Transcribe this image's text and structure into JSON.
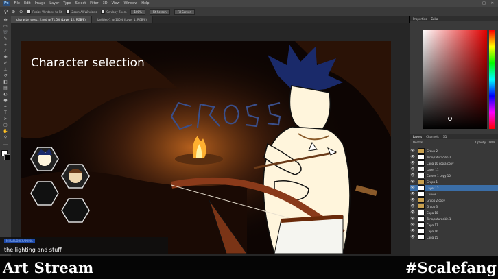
{
  "menubar": {
    "app_logo": "Ps",
    "items": [
      "File",
      "Edit",
      "Image",
      "Layer",
      "Type",
      "Select",
      "Filter",
      "3D",
      "View",
      "Window",
      "Help"
    ]
  },
  "options_bar": {
    "checkboxes": [
      "Resize Windows to Fit",
      "Zoom All Windows",
      "Scrubby Zoom"
    ],
    "buttons": [
      "100%",
      "Fit Screen",
      "Fill Screen"
    ]
  },
  "document_tabs": [
    {
      "label": "character select 2.psd @ 71.5% (Layer 12, RGB/8)",
      "active": true
    },
    {
      "label": "Untitled-1 @ 100% (Layer 1, RGB/8)",
      "active": false
    }
  ],
  "right_panel": {
    "color_tabs": [
      "Properties",
      "Color"
    ],
    "layers_tabs": [
      "Layers",
      "Channels",
      "3D"
    ],
    "blend_mode": "Normal",
    "opacity_label": "Opacity: 100%",
    "layers": [
      {
        "name": "Group 2",
        "folder": true,
        "selected": false
      },
      {
        "name": "Tono/saturación 2",
        "folder": false,
        "selected": false
      },
      {
        "name": "Capa 10 copia copy",
        "folder": false,
        "selected": false
      },
      {
        "name": "Layer 11",
        "folder": false,
        "selected": false
      },
      {
        "name": "Curves 1 copy 10",
        "folder": false,
        "selected": false
      },
      {
        "name": "Grupo 1",
        "folder": true,
        "selected": false
      },
      {
        "name": "Layer 12",
        "folder": false,
        "selected": true
      },
      {
        "name": "Curves 1",
        "folder": false,
        "selected": false
      },
      {
        "name": "Grupo 2 copy",
        "folder": true,
        "selected": false
      },
      {
        "name": "Grupo 3",
        "folder": true,
        "selected": false
      },
      {
        "name": "Capa 18",
        "folder": false,
        "selected": false
      },
      {
        "name": "Tono/saturación 1",
        "folder": false,
        "selected": false
      },
      {
        "name": "Capa 17",
        "folder": false,
        "selected": false
      },
      {
        "name": "Capa 16",
        "folder": false,
        "selected": false
      },
      {
        "name": "Capa 15",
        "folder": false,
        "selected": false
      }
    ]
  },
  "canvas": {
    "title": "Character selection",
    "logo_text": "CROSS"
  },
  "subtitle": {
    "speaker": "MIRAFLORESANIMA",
    "text": "the lighting and stuff"
  },
  "stream_overlay": {
    "left": "Art Stream",
    "right": "#Scalefang"
  },
  "colors": {
    "accent_blue": "#3b6ea7",
    "fire": "#ffb030",
    "cave": "#5a2a10"
  }
}
